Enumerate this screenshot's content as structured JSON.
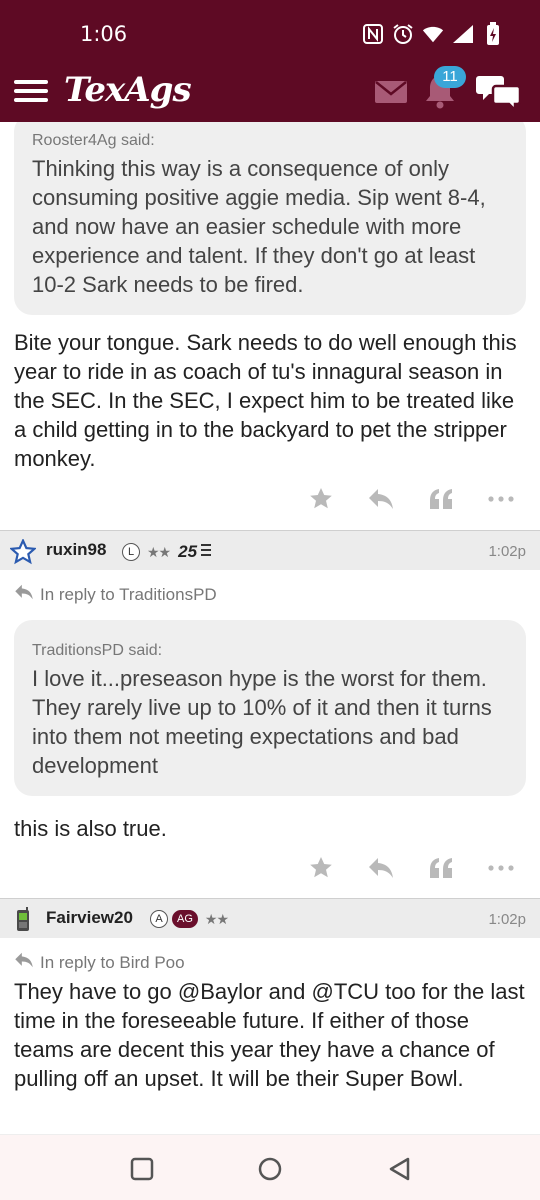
{
  "status_bar": {
    "time": "1:06",
    "icons": [
      "nfc-icon",
      "alarm-icon",
      "wifi-icon",
      "signal-icon",
      "battery-charging-icon"
    ]
  },
  "app_bar": {
    "logo": "TexAgs",
    "notification_count": "11",
    "colors": {
      "brand": "#5e0a24",
      "badge": "#3aa6d8"
    }
  },
  "posts": [
    {
      "quote": {
        "author": "Rooster4Ag said:",
        "text": "Thinking this way is a consequence of only consuming positive aggie media. Sip went 8-4, and now have an easier schedule with more experience and talent. If they don't go at least 10-2 Sark needs to be fired."
      },
      "body": "Bite your tongue. Sark needs to do well enough this year to ride in as coach of tu's innagural season in the SEC. In the SEC, I expect him to be treated like a child getting in to the backyard to pet the stripper monkey."
    },
    {
      "username": "ruxin98",
      "badges": [
        "L"
      ],
      "stars": "★★",
      "rank": "25",
      "time": "1:02p",
      "reply_to": "In reply to TraditionsPD",
      "quote": {
        "author": "TraditionsPD said:",
        "text": "I love it...preseason hype is the worst for them. They rarely live up to 10% of it and then it turns into them not meeting expectations and bad development"
      },
      "body": "this is also true."
    },
    {
      "username": "Fairview20",
      "badges": [
        "A",
        "AG"
      ],
      "stars": "★★",
      "time": "1:02p",
      "reply_to": "In reply to Bird Poo",
      "body": "They have to go @Baylor and @TCU too for the last time in the foreseeable future. If either of those teams are decent this year they have a chance of pulling off an upset. It will be their Super Bowl."
    }
  ],
  "nav_bar": {
    "buttons": [
      "recents-icon",
      "home-icon",
      "back-icon"
    ]
  }
}
